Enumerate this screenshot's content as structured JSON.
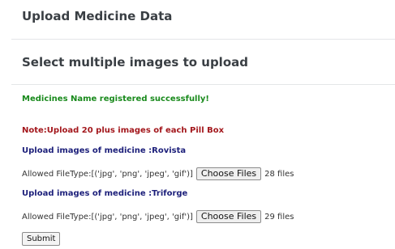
{
  "header": {
    "title": "Upload Medicine Data"
  },
  "section": {
    "title": "Select multiple images to upload"
  },
  "messages": {
    "success": "Medicines Name registered successfully!",
    "note": "Note:Upload 20 plus images of each Pill Box"
  },
  "uploads": [
    {
      "label": "Upload images of medicine :Rovista",
      "allowed_types": "Allowed FileType:[('jpg', 'png', 'jpeg', 'gif')]",
      "button_label": "Choose Files",
      "file_count": "28 files"
    },
    {
      "label": "Upload images of medicine :Triforge",
      "allowed_types": "Allowed FileType:[('jpg', 'png', 'jpeg', 'gif')]",
      "button_label": "Choose Files",
      "file_count": "29 files"
    }
  ],
  "form": {
    "submit_label": "Submit"
  },
  "colors": {
    "success": "#198a1c",
    "note": "#a3171c",
    "upload_label": "#1c1f7a",
    "title": "#3a3f44"
  }
}
